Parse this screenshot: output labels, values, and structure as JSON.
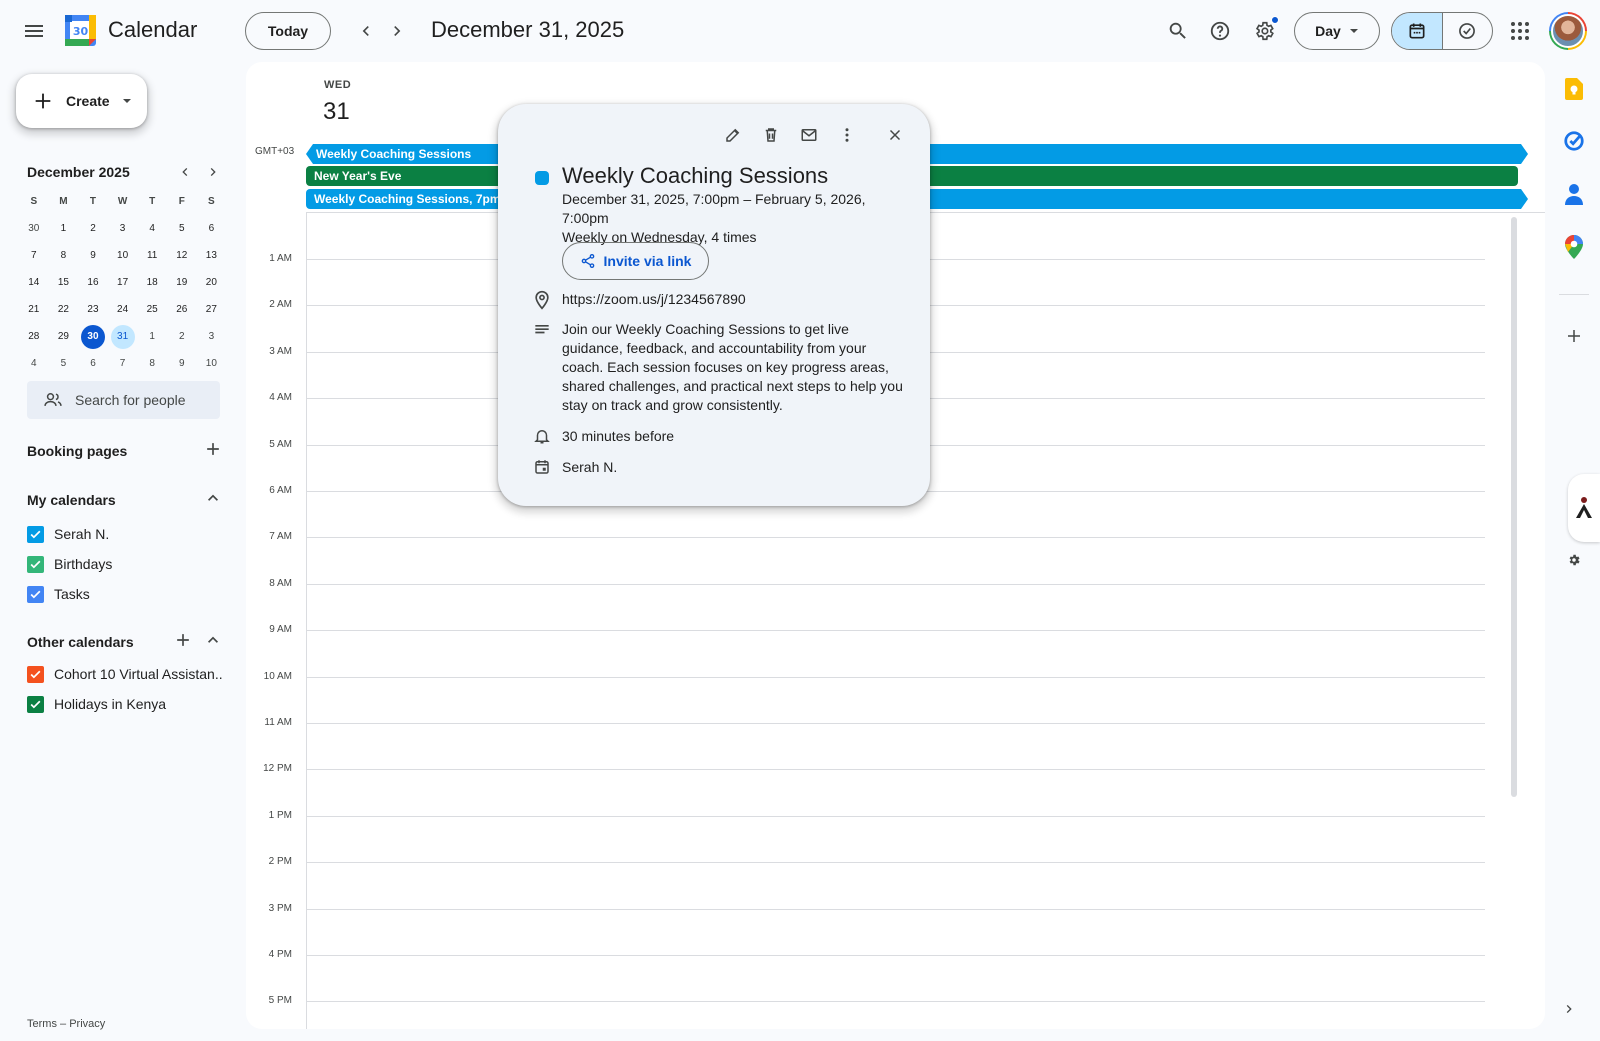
{
  "app": {
    "title": "Calendar",
    "logo_day": "30"
  },
  "header": {
    "today_label": "Today",
    "date_title": "December 31, 2025",
    "view_label": "Day"
  },
  "sidebar": {
    "create_label": "Create",
    "mini_calendar": {
      "title": "December 2025",
      "weekdays": [
        "S",
        "M",
        "T",
        "W",
        "T",
        "F",
        "S"
      ],
      "weeks": [
        [
          "30",
          "1",
          "2",
          "3",
          "4",
          "5",
          "6"
        ],
        [
          "7",
          "8",
          "9",
          "10",
          "11",
          "12",
          "13"
        ],
        [
          "14",
          "15",
          "16",
          "17",
          "18",
          "19",
          "20"
        ],
        [
          "21",
          "22",
          "23",
          "24",
          "25",
          "26",
          "27"
        ],
        [
          "28",
          "29",
          "30",
          "31",
          "1",
          "2",
          "3"
        ],
        [
          "4",
          "5",
          "6",
          "7",
          "8",
          "9",
          "10"
        ]
      ],
      "today": "30",
      "selected": "31"
    },
    "people_search_placeholder": "Search for people",
    "booking_pages_label": "Booking pages",
    "my_calendars_label": "My calendars",
    "my_calendars": [
      {
        "name": "Serah N.",
        "color": "#039be5"
      },
      {
        "name": "Birthdays",
        "color": "#33b679"
      },
      {
        "name": "Tasks",
        "color": "#4285f4"
      }
    ],
    "other_calendars_label": "Other calendars",
    "other_calendars": [
      {
        "name": "Cohort 10 Virtual Assistan...",
        "color": "#f4511e"
      },
      {
        "name": "Holidays in Kenya",
        "color": "#0b8043"
      }
    ],
    "footer": {
      "terms": "Terms",
      "separator": "–",
      "privacy": "Privacy"
    }
  },
  "day_view": {
    "weekday": "WED",
    "day_number": "31",
    "timezone": "GMT+03",
    "all_day_events": [
      {
        "title": "Weekly Coaching Sessions",
        "color": "#039be5"
      },
      {
        "title": "New Year's Eve",
        "color": "#0b8043"
      },
      {
        "title": "Weekly Coaching Sessions, 7pm",
        "color": "#039be5"
      }
    ],
    "hours": [
      "1 AM",
      "2 AM",
      "3 AM",
      "4 AM",
      "5 AM",
      "6 AM",
      "7 AM",
      "8 AM",
      "9 AM",
      "10 AM",
      "11 AM",
      "12 PM",
      "1 PM",
      "2 PM",
      "3 PM",
      "4 PM",
      "5 PM"
    ]
  },
  "event_popup": {
    "title": "Weekly Coaching Sessions",
    "color": "#039be5",
    "datetime": "December 31, 2025, 7:00pm – February 5, 2026, 7:00pm",
    "recurrence": "Weekly on Wednesday, 4 times",
    "invite_label": "Invite via link",
    "location": "https://zoom.us/j/1234567890",
    "description": "Join our Weekly Coaching Sessions to get live guidance, feedback, and accountability from your coach. Each session focuses on key progress areas, shared challenges, and practical next steps to help you stay on track and grow consistently.",
    "reminder": "30 minutes before",
    "calendar_owner": "Serah N."
  },
  "colors": {
    "accent": "#0b57d0",
    "event_blue": "#039be5",
    "event_green": "#0b8043",
    "selected_chip": "#c2e7ff"
  }
}
